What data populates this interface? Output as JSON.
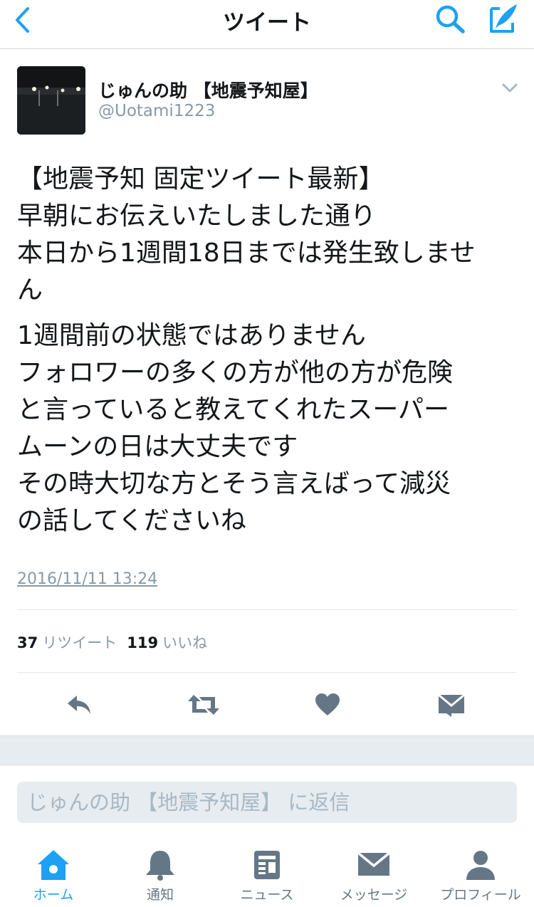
{
  "nav": {
    "title": "ツイート",
    "accent_color": "#1da1f2",
    "icons": [
      "back-chevron-icon",
      "search-icon",
      "compose-quill-icon"
    ]
  },
  "tweet": {
    "username": "じゅんの助 【地震予知屋】",
    "handle": "@Uotami1223",
    "body_paragraphs": [
      [
        "【地震予知 固定ツイート最新】",
        "早朝にお伝えいたしました通り",
        "本日から1週間18日までは発生致しませ",
        "ん"
      ],
      [
        "1週間前の状態ではありません",
        "フォロワーの多くの方が他の方が危険",
        "と言っていると教えてくれたスーパー",
        "ムーンの日は大丈夫です",
        "その時大切な方とそう言えばって減災",
        "の話してくださいね"
      ]
    ],
    "timestamp": "2016/11/11 13:24",
    "retweet_count": "37",
    "retweet_label": "リツイート",
    "like_count": "119",
    "like_label": "いいね"
  },
  "actions": [
    "reply-icon",
    "retweet-icon",
    "like-heart-icon",
    "direct-message-icon"
  ],
  "reply_box": {
    "placeholder": "じゅんの助 【地震予知屋】 に返信"
  },
  "tabbar": {
    "items": [
      {
        "label": "ホーム",
        "icon": "home-icon",
        "active": true
      },
      {
        "label": "通知",
        "icon": "bell-icon",
        "active": false
      },
      {
        "label": "ニュース",
        "icon": "news-icon",
        "active": false
      },
      {
        "label": "メッセージ",
        "icon": "envelope-icon",
        "active": false
      },
      {
        "label": "プロフィール",
        "icon": "profile-icon",
        "active": false
      }
    ]
  }
}
